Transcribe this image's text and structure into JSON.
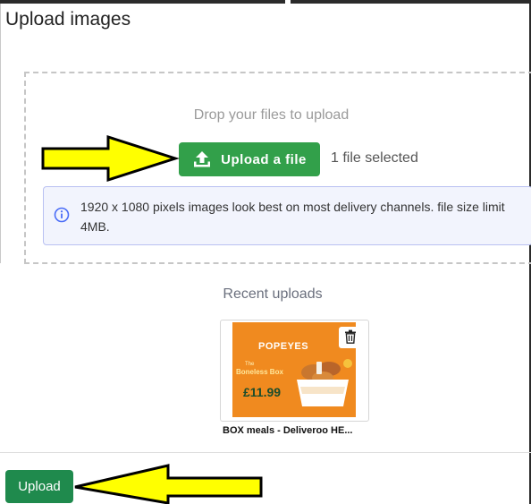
{
  "dialog": {
    "title": "Upload images"
  },
  "dropzone": {
    "instruction": "Drop your files to upload",
    "upload_button_label": "Upload a file",
    "file_status": "1 file selected",
    "info_text": "1920 x 1080 pixels images look best on most delivery channels. file size limit 4MB."
  },
  "recent": {
    "title": "Recent uploads",
    "items": [
      {
        "caption": "BOX meals - Deliveroo HE...",
        "image_brand": "POPEYES",
        "image_product_prefix": "The",
        "image_product": "Boneless Box",
        "image_price": "£11.99"
      }
    ]
  },
  "footer": {
    "upload_label": "Upload"
  },
  "icons": {
    "upload": "upload-icon",
    "info": "info-icon",
    "delete": "trash-icon",
    "annotation": "arrow-icon"
  },
  "colors": {
    "primary_green": "#32a04a",
    "footer_green": "#1f8a4d",
    "info_background": "#f2f4fd",
    "info_border": "#b9c1f2",
    "annotation_yellow": "#ffff00"
  }
}
